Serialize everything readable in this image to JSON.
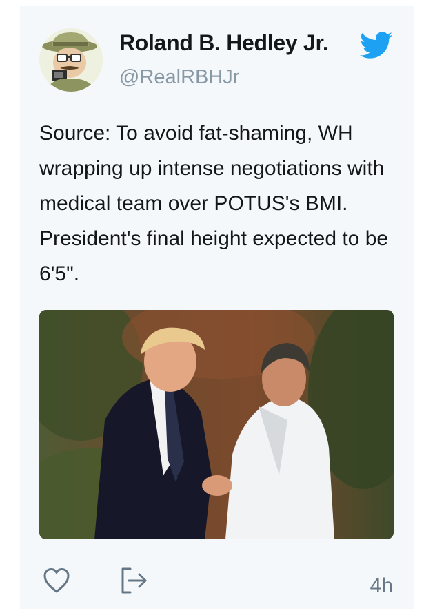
{
  "tweet": {
    "author": {
      "display_name": "Roland B. Hedley Jr.",
      "handle": "@RealRBHJr",
      "avatar_icon": "cartoon-reporter-avatar"
    },
    "brand_icon": "twitter-bird-icon",
    "brand_color": "#1da1f2",
    "text": "Source: To avoid fat-shaming, WH wrapping up intense negotiations with medical team over POTUS's BMI. President's final height expected to be 6'5\".",
    "media": {
      "kind": "photo",
      "description_icon": "two-men-shaking-hands-photo"
    },
    "actions": {
      "like_icon": "heart-icon",
      "share_icon": "share-icon"
    },
    "timestamp": "4h"
  },
  "colors": {
    "card_background": "#f5f8fa",
    "text_primary": "#14171a",
    "text_secondary": "#8899a6",
    "icon_gray": "#657786"
  }
}
